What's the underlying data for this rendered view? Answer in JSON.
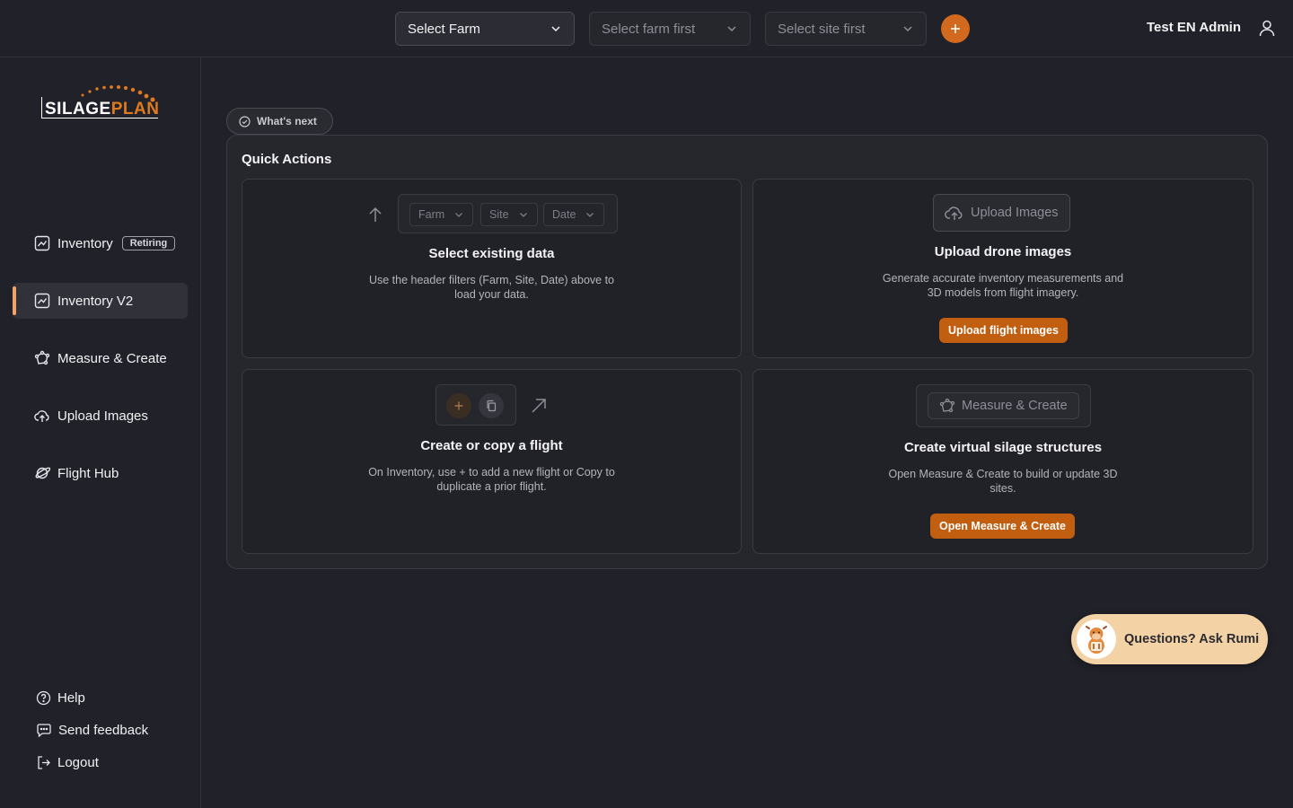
{
  "header": {
    "farm_select": "Select Farm",
    "farm_first": "Select farm first",
    "site_first": "Select site first",
    "user_name": "Test EN Admin"
  },
  "brand": {
    "logo_text_1": "SILAGE",
    "logo_text_2": "PLAN",
    "accent_color": "#d2691e"
  },
  "sidebar": {
    "items": [
      {
        "label": "Inventory",
        "badge": "Retiring",
        "icon": "chart-icon"
      },
      {
        "label": "Inventory V2",
        "icon": "chart-icon",
        "active": true
      },
      {
        "label": "Measure & Create",
        "icon": "polygon-icon"
      },
      {
        "label": "Upload Images",
        "icon": "cloud-upload-icon"
      },
      {
        "label": "Flight Hub",
        "icon": "planet-icon"
      }
    ],
    "footer": {
      "help": "Help",
      "feedback": "Send feedback",
      "logout": "Logout"
    }
  },
  "main": {
    "whats_next": "What's next",
    "quick_actions_title": "Quick Actions",
    "cards": {
      "select": {
        "filters": [
          "Farm",
          "Site",
          "Date"
        ],
        "title": "Select existing data",
        "desc_1": "Use the header filters (Farm, Site, Date) above to",
        "desc_2": "load your data."
      },
      "upload": {
        "ghost_label": "Upload Images",
        "title": "Upload drone images",
        "desc_1": "Generate accurate inventory measurements and",
        "desc_2": "3D models from flight imagery.",
        "button": "Upload flight images"
      },
      "flight": {
        "title": "Create or copy a flight",
        "desc_1": "On Inventory, use + to add a new flight or Copy to",
        "desc_2": "duplicate a prior flight."
      },
      "measure": {
        "ghost_label": "Measure & Create",
        "title": "Create virtual silage structures",
        "desc_1": "Open Measure & Create to build or update 3D",
        "desc_2": "sites.",
        "button": "Open Measure & Create"
      }
    }
  },
  "assistant": {
    "label": "Questions? Ask Rumi"
  }
}
